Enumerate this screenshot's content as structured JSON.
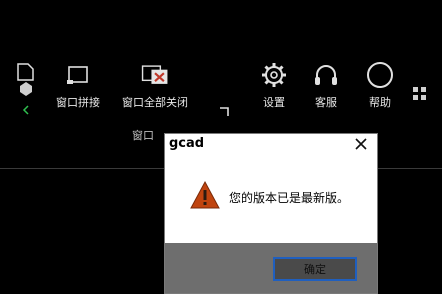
{
  "toolbar": {
    "items": [
      {
        "label": "窗口拼接",
        "icon": "window-tile-icon"
      },
      {
        "label": "窗口全部关闭",
        "icon": "close-all-windows-icon"
      },
      {
        "label": "设置",
        "icon": "gear-icon"
      },
      {
        "label": "客服",
        "icon": "headset-icon"
      },
      {
        "label": "帮助",
        "icon": "help-icon"
      }
    ],
    "group_label": "窗口"
  },
  "dialog": {
    "title": "gcad",
    "message": "您的版本已是最新版。",
    "ok_label": "确定",
    "icon": "warning-icon"
  },
  "colors": {
    "background": "#000000",
    "dialog_bg": "#ffffff",
    "footer_bg": "#6e6e6e",
    "ok_border": "#1f5fbf",
    "warning_fill": "#c0440f"
  }
}
